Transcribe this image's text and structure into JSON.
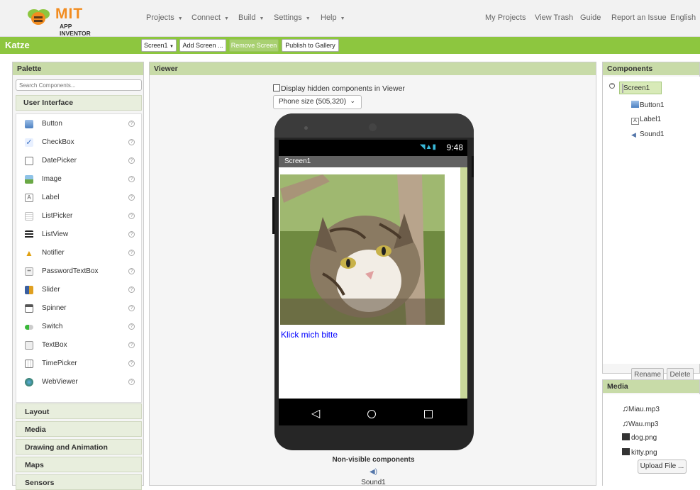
{
  "logo": {
    "mit": "MIT",
    "sub": "APP INVENTOR"
  },
  "topmenu": {
    "projects": "Projects",
    "connect": "Connect",
    "build": "Build",
    "settings": "Settings",
    "help": "Help",
    "my_projects": "My Projects",
    "view_trash": "View Trash",
    "guide": "Guide",
    "report": "Report an Issue",
    "language": "English"
  },
  "project": {
    "name": "Katze"
  },
  "toolbar": {
    "screen_select": "Screen1",
    "add_screen": "Add Screen ...",
    "remove_screen": "Remove Screen",
    "publish": "Publish to Gallery"
  },
  "palette": {
    "title": "Palette",
    "search_placeholder": "Search Components...",
    "open_category": "User Interface",
    "items": [
      "Button",
      "CheckBox",
      "DatePicker",
      "Image",
      "Label",
      "ListPicker",
      "ListView",
      "Notifier",
      "PasswordTextBox",
      "Slider",
      "Spinner",
      "Switch",
      "TextBox",
      "TimePicker",
      "WebViewer"
    ],
    "help_glyph": "?",
    "categories": [
      "Layout",
      "Media",
      "Drawing and Animation",
      "Maps",
      "Sensors"
    ]
  },
  "viewer": {
    "title": "Viewer",
    "hidden_label": "Display hidden components in Viewer",
    "size_select": "Phone size (505,320)",
    "status_time": "9:48",
    "screen_title": "Screen1",
    "button_text": "Klick mich bitte",
    "nonvisible_title": "Non-visible components",
    "nonvisible_item": "Sound1"
  },
  "components": {
    "title": "Components",
    "tree": {
      "root": "Screen1",
      "children": [
        "Button1",
        "Label1",
        "Sound1"
      ]
    },
    "rename": "Rename",
    "delete": "Delete"
  },
  "media": {
    "title": "Media",
    "files": [
      "Miau.mp3",
      "Wau.mp3",
      "dog.png",
      "kitty.png"
    ],
    "upload": "Upload File ..."
  },
  "colors": {
    "brand_green": "#8dc63f",
    "panel_header": "#c8dba8",
    "link_blue": "#0000ff"
  }
}
